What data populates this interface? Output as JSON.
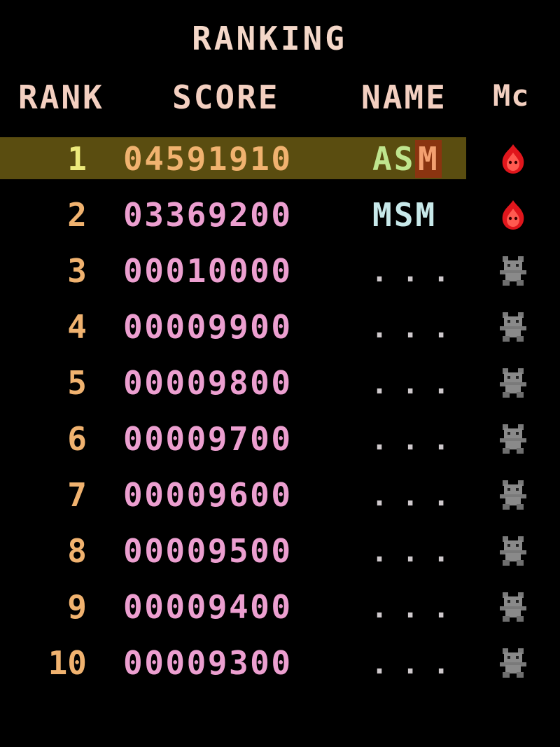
{
  "title": "RANKING",
  "headers": {
    "rank": "RANK",
    "score": "SCORE",
    "name": "NAME",
    "mc": "Mc"
  },
  "rows": [
    {
      "rank": "1",
      "score": "04591910",
      "name_main": "AS",
      "name_cursor": "M",
      "mc_icon": "red-fire-icon"
    },
    {
      "rank": "2",
      "score": "03369200",
      "name": "MSM",
      "mc_icon": "red-fire-icon"
    },
    {
      "rank": "3",
      "score": "00010000",
      "placeholder": "...",
      "mc_icon": "gray-creature-icon"
    },
    {
      "rank": "4",
      "score": "00009900",
      "placeholder": "...",
      "mc_icon": "gray-creature-icon"
    },
    {
      "rank": "5",
      "score": "00009800",
      "placeholder": "...",
      "mc_icon": "gray-creature-icon"
    },
    {
      "rank": "6",
      "score": "00009700",
      "placeholder": "...",
      "mc_icon": "gray-creature-icon"
    },
    {
      "rank": "7",
      "score": "00009600",
      "placeholder": "...",
      "mc_icon": "gray-creature-icon"
    },
    {
      "rank": "8",
      "score": "00009500",
      "placeholder": "...",
      "mc_icon": "gray-creature-icon"
    },
    {
      "rank": "9",
      "score": "00009400",
      "placeholder": "...",
      "mc_icon": "gray-creature-icon"
    },
    {
      "rank": "10",
      "score": "00009300",
      "placeholder": "...",
      "mc_icon": "gray-creature-icon"
    }
  ],
  "colors": {
    "background": "#000000",
    "highlight_bar": "#5a4d10",
    "rank_text": "#f0b26f",
    "score_text": "#ec9fd0",
    "header_text": "#f3cfc0",
    "name_text": "#c8e9ea",
    "entry_green": "#bfe58e",
    "cursor_bg": "#8a3410",
    "fire_red": "#e0161c",
    "creature_gray": "#8a8a8a"
  }
}
